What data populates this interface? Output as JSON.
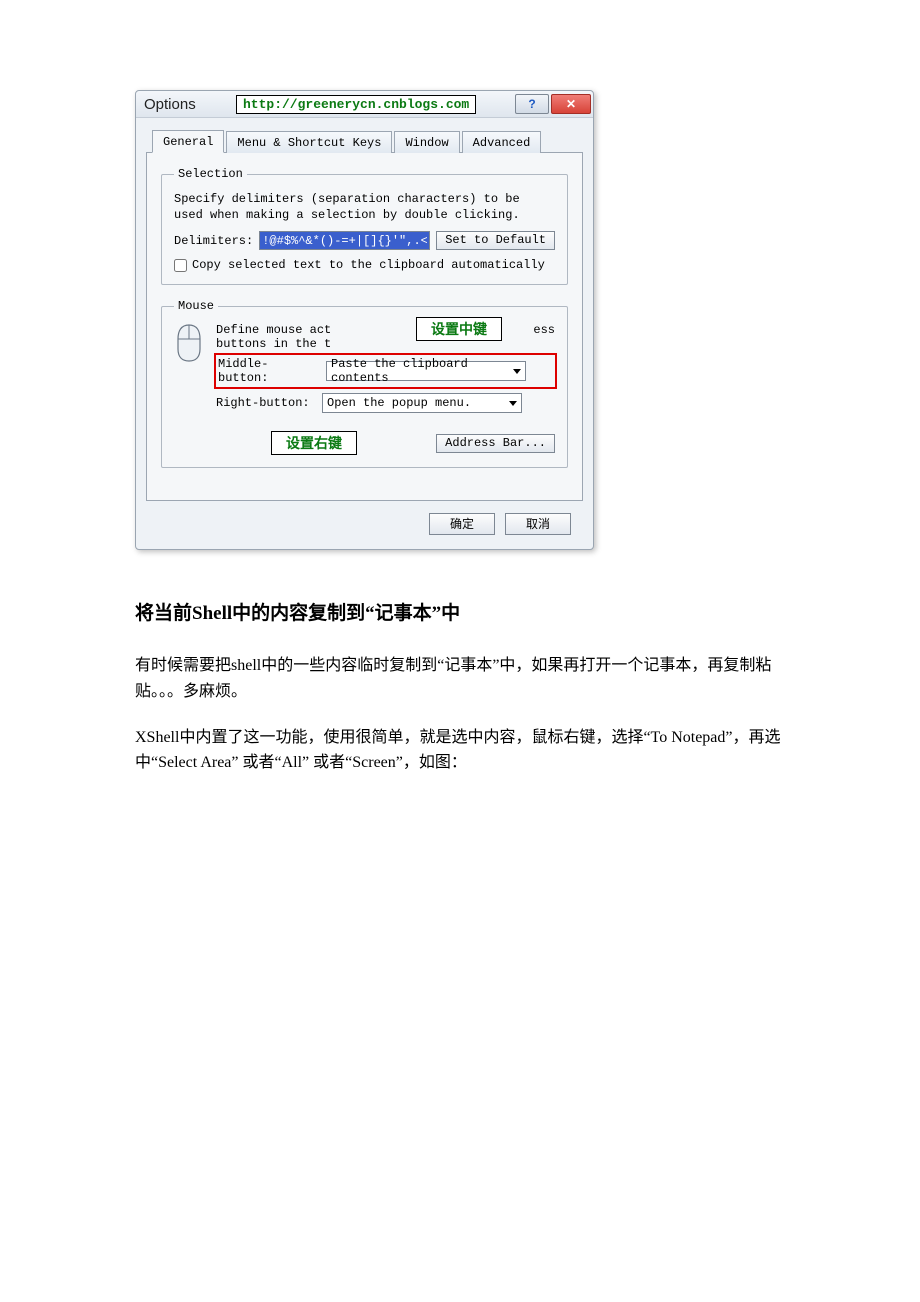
{
  "dialog": {
    "title": "Options",
    "url_stamp": "http://greenerycn.cnblogs.com",
    "tabs": [
      "General",
      "Menu & Shortcut Keys",
      "Window",
      "Advanced"
    ],
    "active_tab_index": 0,
    "selection": {
      "legend": "Selection",
      "desc": "Specify delimiters (separation characters) to be used when making a selection by double clicking.",
      "delim_label": "Delimiters:",
      "delim_value": "!@#$%^&*()-=+|[]{}'\",.<>/?",
      "set_default": "Set to Default",
      "auto_copy": "Copy selected text to the clipboard automatically"
    },
    "mouse": {
      "legend": "Mouse",
      "desc_line": "Define mouse act",
      "desc_line2": "buttons in the t",
      "desc_tail": "ess",
      "callout_mid": "设置中键",
      "callout_right": "设置右键",
      "mid_label": "Middle-button:",
      "mid_value": "Paste the clipboard contents",
      "right_label": "Right-button:",
      "right_value": "Open the popup menu.",
      "address_bar": "Address Bar..."
    },
    "ok": "确定",
    "cancel": "取消"
  },
  "article": {
    "heading": "将当前Shell中的内容复制到“记事本”中",
    "p1": "有时候需要把shell中的一些内容临时复制到“记事本”中，如果再打开一个记事本，再复制粘贴。。。多麻烦。",
    "p2": "XShell中内置了这一功能，使用很简单，就是选中内容，鼠标右键，选择“To Notepad”，再选中“Select Area” 或者“All” 或者“Screen”，如图："
  }
}
